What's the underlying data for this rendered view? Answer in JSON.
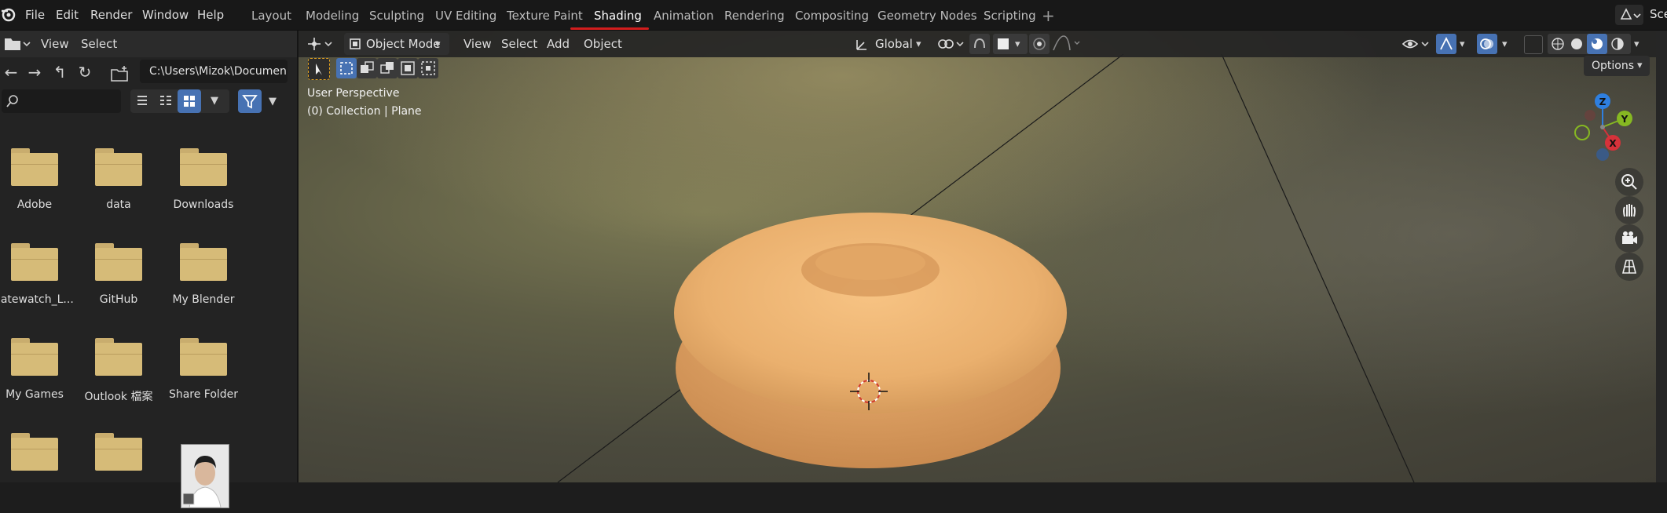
{
  "menubar": {
    "items": [
      "File",
      "Edit",
      "Render",
      "Window",
      "Help"
    ]
  },
  "workspaces": {
    "tabs": [
      "Layout",
      "Modeling",
      "Sculpting",
      "UV Editing",
      "Texture Paint",
      "Shading",
      "Animation",
      "Rendering",
      "Compositing",
      "Geometry Nodes",
      "Scripting"
    ],
    "active": "Shading",
    "add_label": "+"
  },
  "scene": {
    "label": "Sce"
  },
  "file_browser": {
    "header": {
      "view": "View",
      "select": "Select"
    },
    "path": "C:\\Users\\Mizok\\Documen...",
    "items": [
      "Adobe",
      "data",
      "Downloads",
      "Gatewatch_L...",
      "GitHub",
      "My Blender",
      "My Games",
      "Outlook 檔案",
      "Share Folder",
      "",
      "",
      ""
    ]
  },
  "viewport": {
    "header": {
      "mode": "Object Mode",
      "view": "View",
      "select": "Select",
      "add": "Add",
      "object": "Object",
      "orientation": "Global"
    },
    "perspective": "User Perspective",
    "collection": "(0) Collection | Plane",
    "options_label": "Options",
    "gizmo": {
      "z": "Z",
      "y": "Y",
      "x": "X"
    },
    "colors": {
      "x": "#d6323a",
      "y": "#86b822",
      "z": "#2e7fe0",
      "accent": "#4772b3",
      "workspace_underline": "#d21d1d"
    }
  }
}
